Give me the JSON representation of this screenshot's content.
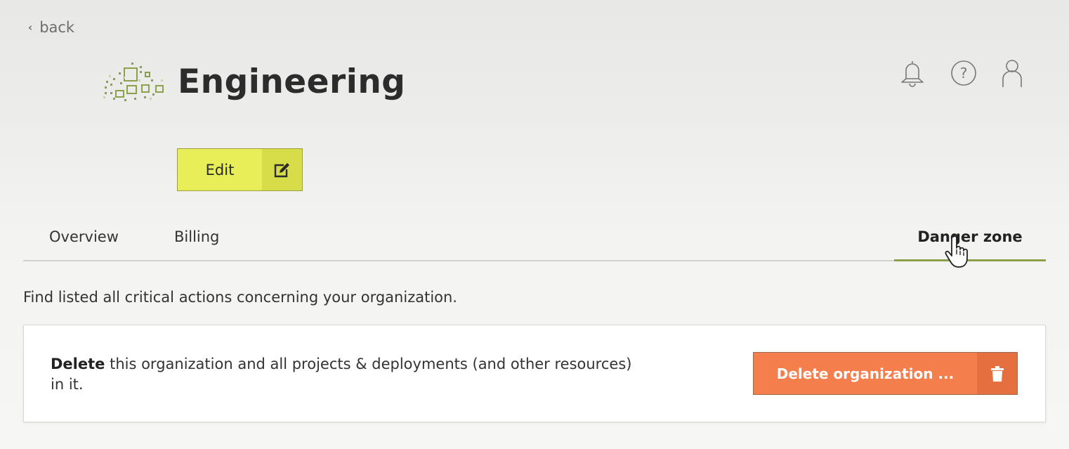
{
  "nav": {
    "back_label": "back"
  },
  "header": {
    "title": "Engineering",
    "logo_icon": "organization-pixel-logo",
    "actions": [
      {
        "icon": "bell-icon",
        "label": "Notifications"
      },
      {
        "icon": "help-circle-icon",
        "label": "Help"
      },
      {
        "icon": "user-icon",
        "label": "Account"
      }
    ]
  },
  "edit_button": {
    "label": "Edit",
    "icon": "edit-icon"
  },
  "tabs": [
    {
      "label": "Overview",
      "active": false
    },
    {
      "label": "Billing",
      "active": false
    },
    {
      "label": "Danger zone",
      "active": true
    }
  ],
  "danger_zone": {
    "description": "Find listed all critical actions concerning your organization.",
    "delete_card": {
      "bold_text": "Delete",
      "text": " this organization and all projects & deployments (and other resources) in it.",
      "button_label": "Delete organization ...",
      "button_icon": "trash-icon"
    }
  },
  "colors": {
    "accent_green": "#e7ee58",
    "tab_underline": "#8aa04a",
    "danger_orange": "#f47f4c",
    "logo_green": "#8aa04a"
  }
}
